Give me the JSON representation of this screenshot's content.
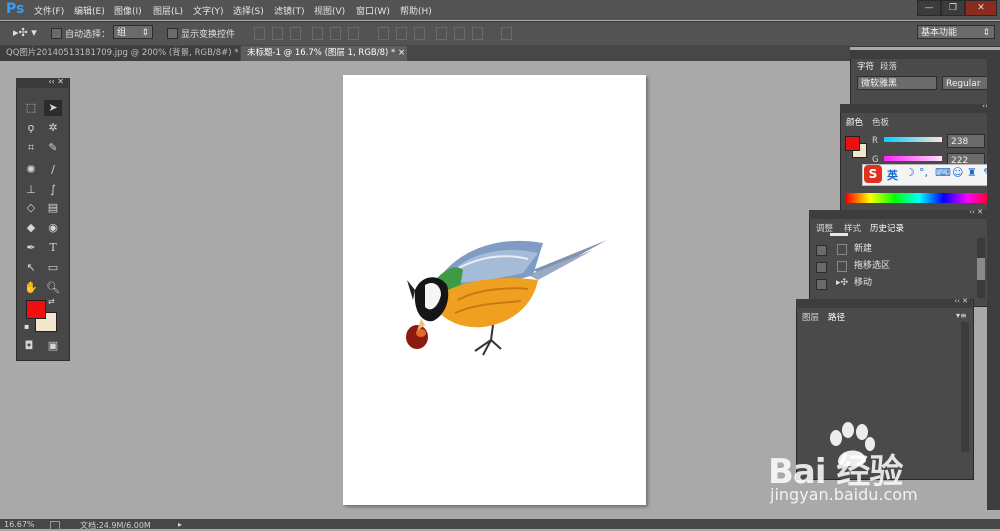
{
  "app": {
    "logo": "Ps"
  },
  "menu": [
    "文件(F)",
    "编辑(E)",
    "图像(I)",
    "图层(L)",
    "文字(Y)",
    "选择(S)",
    "滤镜(T)",
    "视图(V)",
    "窗口(W)",
    "帮助(H)"
  ],
  "window_buttons": {
    "minimize": "—",
    "restore": "❐",
    "close": "✕"
  },
  "options_bar": {
    "auto_select_label": "自动选择：",
    "auto_select_value": "组",
    "show_transform_label": "显示变换控件",
    "workspace": "基本功能"
  },
  "tabs": [
    {
      "label": "QQ图片20140513181709.jpg @ 200% (背景, RGB/8#) *",
      "close": "×"
    },
    {
      "label": "未标题-1 @ 16.7% (图层 1, RGB/8) *",
      "close": "×"
    }
  ],
  "status": {
    "zoom": "16.67%",
    "doc": "文档:24.9M/6.00M"
  },
  "char_panel": {
    "tabs": [
      "字符",
      "段落"
    ],
    "font": "微软雅黑",
    "style": "Regular"
  },
  "color_panel": {
    "tabs": [
      "颜色",
      "色板"
    ],
    "r_label": "R",
    "r_value": "238",
    "g_label": "G",
    "g_value": "222"
  },
  "history_panel": {
    "tabs": [
      "调整",
      "样式",
      "历史记录"
    ],
    "items": [
      "新建",
      "拖移选区",
      "移动"
    ]
  },
  "layers_panel": {
    "tabs": [
      "图层",
      "路径"
    ]
  },
  "ime_toolbar": {
    "logo": "S",
    "mode": "英"
  },
  "watermark": {
    "brand": "Bai 经验",
    "url": "jingyan.baidu.com"
  },
  "colors": {
    "foreground": "#ee0f0f",
    "background": "#f2e6cc",
    "ps_blue": "#30a0ff"
  },
  "icons": [
    "move-tool-icon",
    "marquee-tool-icon",
    "lasso-tool-icon",
    "magic-wand-tool-icon",
    "crop-tool-icon",
    "eyedropper-tool-icon",
    "healing-brush-icon",
    "brush-tool-icon",
    "clone-stamp-icon",
    "history-brush-icon",
    "eraser-tool-icon",
    "gradient-tool-icon",
    "blur-tool-icon",
    "dodge-tool-icon",
    "pen-tool-icon",
    "type-tool-icon",
    "path-select-icon",
    "shape-tool-icon",
    "hand-tool-icon",
    "zoom-tool-icon",
    "quick-mask-icon",
    "screen-mode-icon"
  ]
}
